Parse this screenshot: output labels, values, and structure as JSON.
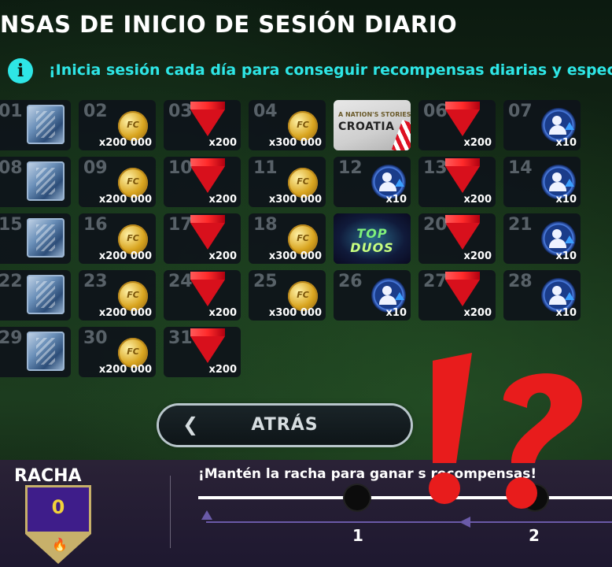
{
  "header": {
    "title": "NSAS DE INICIO DE SESIÓN DIARIO",
    "info_text": "¡Inicia sesión cada día para conseguir recompensas diarias y espec"
  },
  "rewards": [
    {
      "day": "01",
      "type": "pack",
      "qty": ""
    },
    {
      "day": "02",
      "type": "coin",
      "qty": "x200 000"
    },
    {
      "day": "03",
      "type": "gem",
      "qty": "x200"
    },
    {
      "day": "04",
      "type": "coin",
      "qty": "x300 000"
    },
    {
      "day": "",
      "type": "croatia",
      "qty": "",
      "small_text": "A NATION'S STORIES",
      "big_text": "CROATIA"
    },
    {
      "day": "06",
      "type": "gem",
      "qty": "x200"
    },
    {
      "day": "07",
      "type": "boost",
      "qty": "x10"
    },
    {
      "day": "08",
      "type": "pack",
      "qty": ""
    },
    {
      "day": "09",
      "type": "coin",
      "qty": "x200 000"
    },
    {
      "day": "10",
      "type": "gem",
      "qty": "x200"
    },
    {
      "day": "11",
      "type": "coin",
      "qty": "x300 000"
    },
    {
      "day": "12",
      "type": "boost",
      "qty": "x10"
    },
    {
      "day": "13",
      "type": "gem",
      "qty": "x200"
    },
    {
      "day": "14",
      "type": "boost",
      "qty": "x10"
    },
    {
      "day": "15",
      "type": "pack",
      "qty": ""
    },
    {
      "day": "16",
      "type": "coin",
      "qty": "x200 000"
    },
    {
      "day": "17",
      "type": "gem",
      "qty": "x200"
    },
    {
      "day": "18",
      "type": "coin",
      "qty": "x300 000"
    },
    {
      "day": "",
      "type": "duos",
      "qty": "",
      "line1": "TOP",
      "line2": "DUOS"
    },
    {
      "day": "20",
      "type": "gem",
      "qty": "x200"
    },
    {
      "day": "21",
      "type": "boost",
      "qty": "x10"
    },
    {
      "day": "22",
      "type": "pack",
      "qty": ""
    },
    {
      "day": "23",
      "type": "coin",
      "qty": "x200 000"
    },
    {
      "day": "24",
      "type": "gem",
      "qty": "x200"
    },
    {
      "day": "25",
      "type": "coin",
      "qty": "x300 000"
    },
    {
      "day": "26",
      "type": "boost",
      "qty": "x10"
    },
    {
      "day": "27",
      "type": "gem",
      "qty": "x200"
    },
    {
      "day": "28",
      "type": "boost",
      "qty": "x10"
    },
    {
      "day": "29",
      "type": "pack",
      "qty": ""
    },
    {
      "day": "30",
      "type": "coin",
      "qty": "x200 000"
    },
    {
      "day": "31",
      "type": "gem",
      "qty": "x200"
    }
  ],
  "back_button": {
    "label": "ATRÁS",
    "chevron": "❮"
  },
  "streak": {
    "label": "RACHA",
    "count": "0",
    "message": "¡Mantén la racha para ganar   s recompensas!",
    "milestones": [
      "1",
      "2"
    ]
  },
  "icons": {
    "info": "i",
    "flame": "🔥"
  },
  "colors": {
    "accent_cyan": "#2ee6e6",
    "overlay_red": "#e81c1c",
    "streak_purple": "#3e1d8a"
  }
}
